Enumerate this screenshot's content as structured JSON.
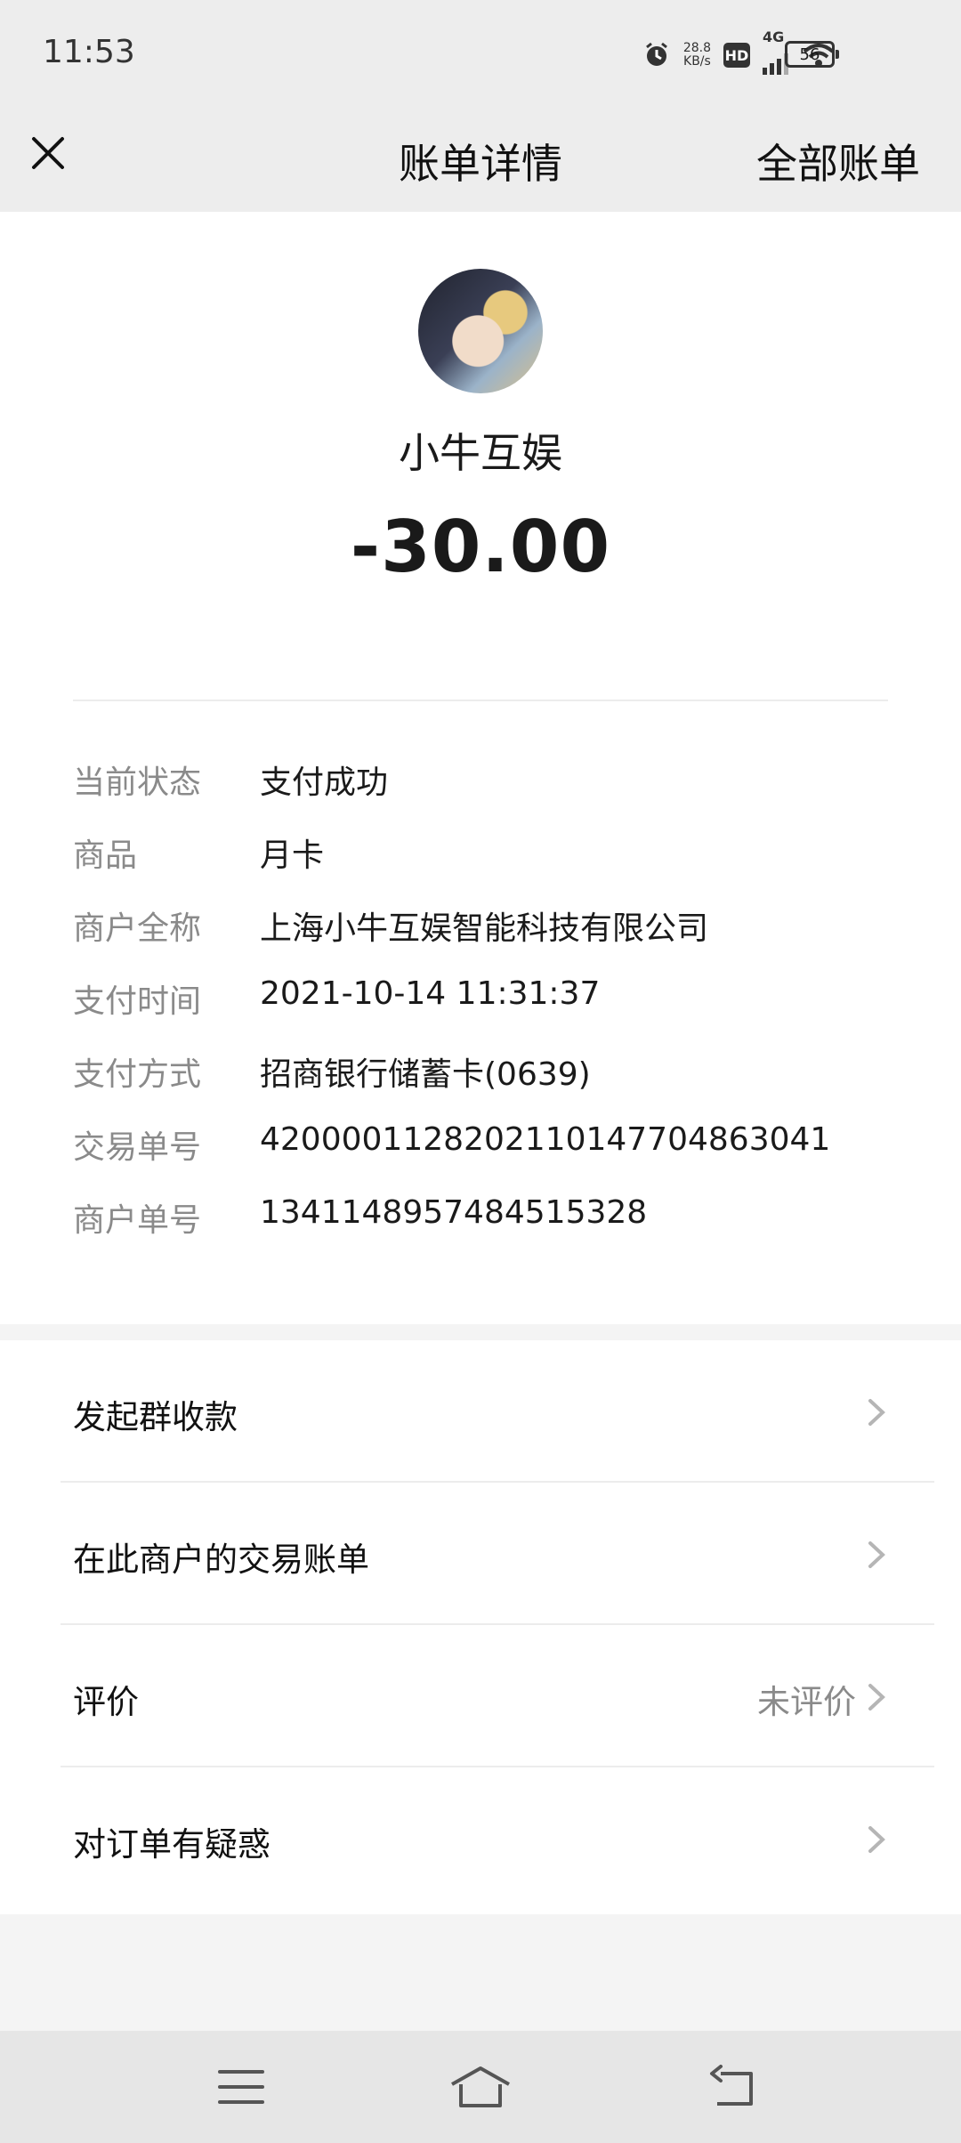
{
  "status_bar": {
    "time": "11:53",
    "net_speed_value": "28.8",
    "net_speed_unit": "KB/s",
    "hd": "HD",
    "network": "4G",
    "battery": "56",
    "icons": [
      "alarm-icon",
      "hd-icon",
      "signal-icon",
      "wifi-icon",
      "battery-icon"
    ]
  },
  "nav": {
    "title": "账单详情",
    "right_link": "全部账单",
    "close_icon": "close-icon"
  },
  "summary": {
    "merchant": "小牛互娱",
    "amount": "-30.00"
  },
  "details": [
    {
      "key": "当前状态",
      "value": "支付成功"
    },
    {
      "key": "商品",
      "value": "月卡"
    },
    {
      "key": "商户全称",
      "value": "上海小牛互娱智能科技有限公司"
    },
    {
      "key": "支付时间",
      "value": "2021-10-14 11:31:37"
    },
    {
      "key": "支付方式",
      "value": "招商银行储蓄卡(0639)"
    },
    {
      "key": "交易单号",
      "value": "4200001128202110147704863041"
    },
    {
      "key": "商户单号",
      "value": "1341148957484515328"
    }
  ],
  "actions": [
    {
      "label": "发起群收款",
      "extra": ""
    },
    {
      "label": "在此商户的交易账单",
      "extra": ""
    },
    {
      "label": "评价",
      "extra": "未评价"
    },
    {
      "label": "对订单有疑惑",
      "extra": ""
    }
  ],
  "system_nav": [
    "menu-icon",
    "home-icon",
    "back-icon"
  ]
}
